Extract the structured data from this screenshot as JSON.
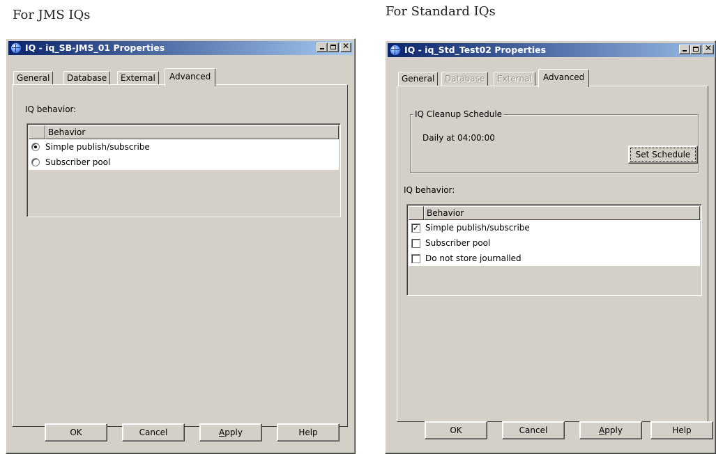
{
  "captions": {
    "left": "For JMS IQs",
    "right": "For Standard IQs"
  },
  "jms_dialog": {
    "title": "IQ - iq_SB-JMS_01 Properties",
    "tabs": [
      {
        "label": "General",
        "disabled": false
      },
      {
        "label": "Database",
        "disabled": false
      },
      {
        "label": "External",
        "disabled": false
      },
      {
        "label": "Advanced",
        "active": true
      }
    ],
    "behavior_label": "IQ behavior:",
    "column_header": "Behavior",
    "options": [
      {
        "label": "Simple publish/subscribe",
        "selected": true
      },
      {
        "label": "Subscriber pool",
        "selected": false
      }
    ],
    "buttons": {
      "ok": "OK",
      "cancel": "Cancel",
      "apply_prefix": "A",
      "apply_rest": "pply",
      "help": "Help"
    }
  },
  "std_dialog": {
    "title": "IQ - iq_Std_Test02 Properties",
    "tabs": [
      {
        "label": "General",
        "disabled": false
      },
      {
        "label": "Database",
        "disabled": true
      },
      {
        "label": "External",
        "disabled": true
      },
      {
        "label": "Advanced",
        "active": true
      }
    ],
    "cleanup_group": "IQ Cleanup Schedule",
    "schedule_text": "Daily at 04:00:00",
    "set_schedule_button": "Set Schedule",
    "behavior_label": "IQ behavior:",
    "column_header": "Behavior",
    "options": [
      {
        "label": "Simple publish/subscribe",
        "checked": true
      },
      {
        "label": "Subscriber pool",
        "checked": false
      },
      {
        "label": "Do not store journalled",
        "checked": false
      }
    ],
    "buttons": {
      "ok": "OK",
      "cancel": "Cancel",
      "apply_prefix": "A",
      "apply_rest": "pply",
      "help": "Help"
    }
  },
  "glyphs": {
    "close": "✕",
    "check": "✓"
  }
}
